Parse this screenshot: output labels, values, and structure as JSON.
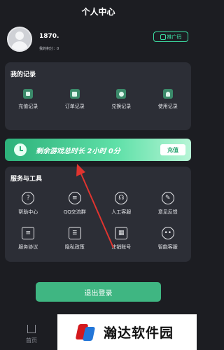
{
  "header": {
    "title": "个人中心"
  },
  "profile": {
    "username": "1870.",
    "points_label": "我的积分：0"
  },
  "promo": {
    "label": "推广码",
    "icon": "qr-code-icon"
  },
  "records": {
    "title": "我的记录",
    "items": [
      {
        "label": "充值记录",
        "icon": "recharge-record-icon"
      },
      {
        "label": "订单记录",
        "icon": "order-record-icon"
      },
      {
        "label": "兑换记录",
        "icon": "exchange-record-icon"
      },
      {
        "label": "使用记录",
        "icon": "usage-record-icon"
      }
    ]
  },
  "banner": {
    "text": "剩余游戏总时长  2小时 0分",
    "button_label": "充值"
  },
  "services": {
    "title": "服务与工具",
    "items": [
      {
        "label": "帮助中心",
        "icon": "help-icon",
        "glyph": "?"
      },
      {
        "label": "QQ交流群",
        "icon": "chat-icon",
        "glyph": "≡"
      },
      {
        "label": "人工客服",
        "icon": "headset-icon",
        "glyph": "☊"
      },
      {
        "label": "意见反馈",
        "icon": "feedback-icon",
        "glyph": "✎"
      },
      {
        "label": "服务协议",
        "icon": "agreement-icon",
        "glyph": "≡"
      },
      {
        "label": "隐私政策",
        "icon": "privacy-icon",
        "glyph": "≣"
      },
      {
        "label": "注销账号",
        "icon": "grid-icon",
        "glyph": "▦"
      },
      {
        "label": "智能客服",
        "icon": "robot-icon",
        "glyph": "••"
      }
    ]
  },
  "logout": {
    "label": "退出登录"
  },
  "tabbar": {
    "home_label": "首页"
  },
  "watermark": {
    "text": "瀚达软件园"
  },
  "colors": {
    "accent": "#3fb682",
    "background": "#1c1d22",
    "card": "#2c2e36"
  }
}
